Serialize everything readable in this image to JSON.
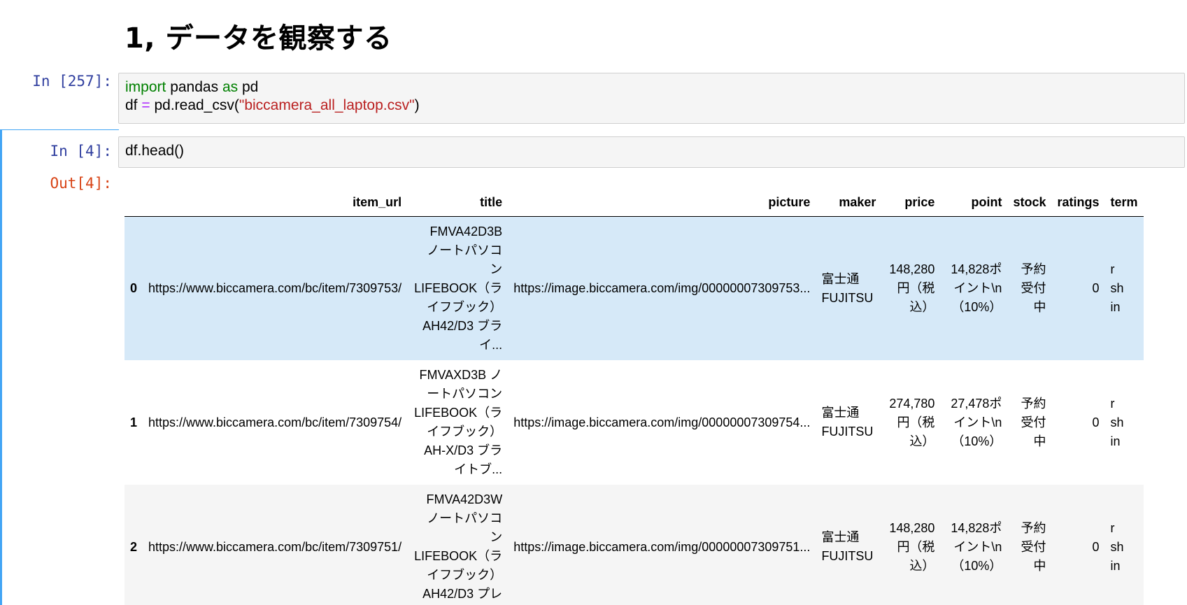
{
  "heading": "1, データを観察する",
  "cells": {
    "c1": {
      "prompt": "In [257]:",
      "line1": {
        "kw1": "import",
        "mid": " pandas ",
        "kw2": "as",
        "end": " pd"
      },
      "line2": {
        "a": "df ",
        "op": "=",
        "b": " pd.read_csv(",
        "str": "\"biccamera_all_laptop.csv\"",
        "c": ")"
      }
    },
    "c2": {
      "prompt": "In [4]:",
      "code": "df.head()",
      "out_prompt": "Out[4]:"
    }
  },
  "table": {
    "columns": [
      "",
      "item_url",
      "title",
      "picture",
      "maker",
      "price",
      "point",
      "stock",
      "ratings",
      "term"
    ],
    "rows": [
      {
        "index": "0",
        "item_url": "https://www.biccamera.com/bc/item/7309753/",
        "title": [
          "FMVA42D3B",
          "ノートパソコ",
          "ン",
          "LIFEBOOK（ラ",
          "イフブック）",
          "AH42/D3 ブラ",
          "イ..."
        ],
        "picture": "https://image.biccamera.com/img/00000007309753...",
        "maker": [
          "富士通",
          "FUJITSU"
        ],
        "price": [
          "148,280",
          "円（税",
          "込）"
        ],
        "point": [
          "14,828ポ",
          "イント\\n",
          "（10%）"
        ],
        "stock": [
          "予約",
          "受付",
          "中"
        ],
        "ratings": "0",
        "term": [
          "r",
          "sh",
          "in"
        ]
      },
      {
        "index": "1",
        "item_url": "https://www.biccamera.com/bc/item/7309754/",
        "title": [
          "FMVAXD3B ノ",
          "ートパソコン",
          "LIFEBOOK（ラ",
          "イフブック）",
          "AH-X/D3 ブラ",
          "イトブ..."
        ],
        "picture": "https://image.biccamera.com/img/00000007309754...",
        "maker": [
          "富士通",
          "FUJITSU"
        ],
        "price": [
          "274,780",
          "円（税",
          "込）"
        ],
        "point": [
          "27,478ポ",
          "イント\\n",
          "（10%）"
        ],
        "stock": [
          "予約",
          "受付",
          "中"
        ],
        "ratings": "0",
        "term": [
          "r",
          "sh",
          "in"
        ]
      },
      {
        "index": "2",
        "item_url": "https://www.biccamera.com/bc/item/7309751/",
        "title": [
          "FMVA42D3W",
          "ノートパソコ",
          "ン",
          "LIFEBOOK（ラ",
          "イフブック）",
          "AH42/D3 プレ"
        ],
        "picture": "https://image.biccamera.com/img/00000007309751...",
        "maker": [
          "富士通",
          "FUJITSU"
        ],
        "price": [
          "148,280",
          "円（税",
          "込）"
        ],
        "point": [
          "14,828ポ",
          "イント\\n",
          "（10%）"
        ],
        "stock": [
          "予約",
          "受付",
          "中"
        ],
        "ratings": "0",
        "term": [
          "r",
          "sh",
          "in"
        ]
      }
    ]
  },
  "colors": {
    "selected_row": "#d6e9f8",
    "in_prompt": "#303f9f",
    "out_prompt": "#d84315",
    "keyword": "#008000",
    "string": "#ba2121",
    "operator": "#aa22ff",
    "cell_selection": "#42a5f5"
  }
}
